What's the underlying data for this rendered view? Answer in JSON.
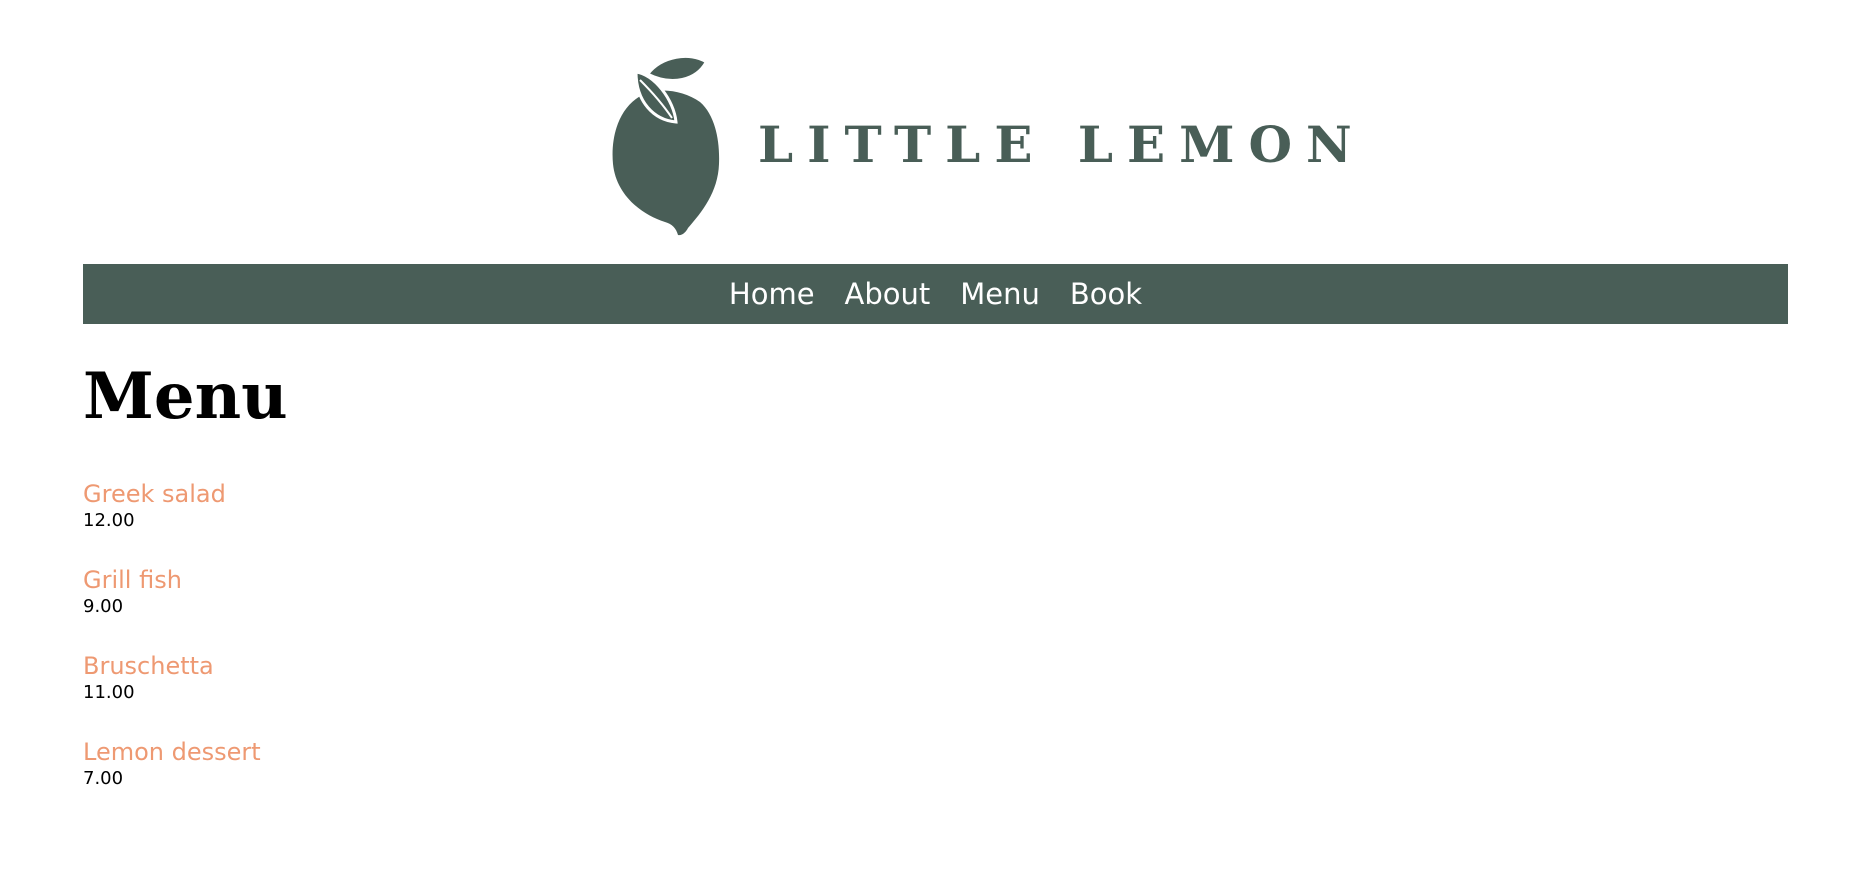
{
  "header": {
    "logo_text": "LITTLE LEMON",
    "logo_icon": "lemon-icon"
  },
  "nav": {
    "items": [
      {
        "label": "Home"
      },
      {
        "label": "About"
      },
      {
        "label": "Menu"
      },
      {
        "label": "Book"
      }
    ]
  },
  "main": {
    "title": "Menu",
    "items": [
      {
        "name": "Greek salad",
        "price": "12.00"
      },
      {
        "name": "Grill fish",
        "price": "9.00"
      },
      {
        "name": "Bruschetta",
        "price": "11.00"
      },
      {
        "name": "Lemon dessert",
        "price": "7.00"
      }
    ]
  },
  "colors": {
    "primary": "#495e57",
    "accent": "#ee9972",
    "background": "#ffffff",
    "text": "#000000"
  }
}
